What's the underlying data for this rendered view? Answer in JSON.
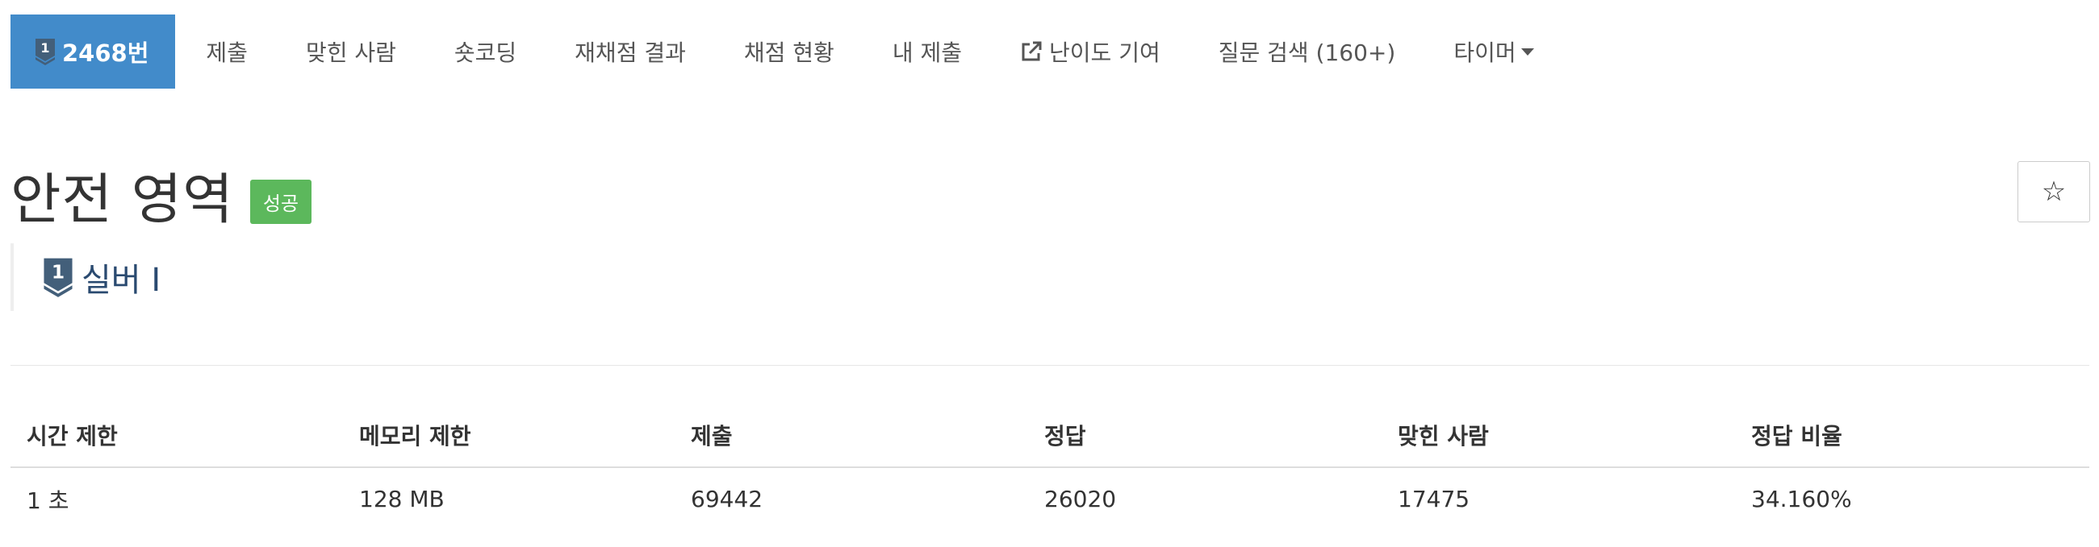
{
  "nav": {
    "problem_number": "2468번",
    "items": [
      "제출",
      "맞힌 사람",
      "숏코딩",
      "재채점 결과",
      "채점 현황",
      "내 제출",
      "난이도 기여",
      "질문 검색 (160+)",
      "타이머"
    ]
  },
  "problem": {
    "title": "안전 영역",
    "status_label": "성공",
    "star": "☆",
    "tier": "실버 I",
    "tier_number": "1"
  },
  "info_table": {
    "headers": [
      "시간 제한",
      "메모리 제한",
      "제출",
      "정답",
      "맞힌 사람",
      "정답 비율"
    ],
    "row": [
      "1 초",
      "128 MB",
      "69442",
      "26020",
      "17475",
      "34.160%"
    ]
  },
  "colors": {
    "nav_active": "#428bca",
    "status_success": "#5cb85c",
    "tier_silver": "#435f7a"
  },
  "icons": {
    "tier": "silver-tier-icon",
    "external_link": "external-link-icon",
    "dropdown": "caret-down-icon",
    "star": "star-outline-icon"
  }
}
